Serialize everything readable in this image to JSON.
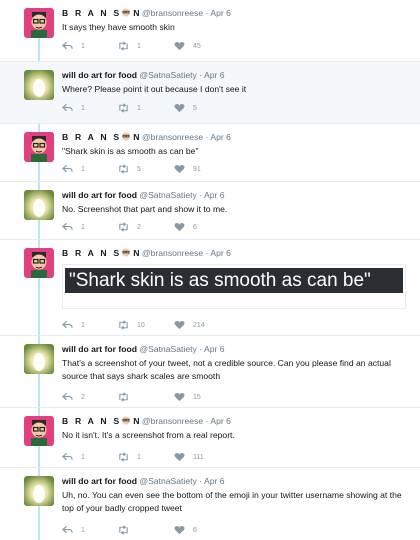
{
  "thread": {
    "tweets": [
      {
        "author": "BRANSON",
        "name_part1": "B R A N S",
        "name_part2": "N",
        "handle": "@bransonreese",
        "date": "Apr 6",
        "text": "It says they have smooth skin",
        "replies": "1",
        "retweets": "1",
        "likes": "45",
        "avatar": "cartoon-face-avatar"
      },
      {
        "author": "will do art for food",
        "handle": "@SatnaSatiety",
        "date": "Apr 6",
        "text": "Where? Please point it out because I don't see it",
        "replies": "1",
        "retweets": "1",
        "likes": "5",
        "avatar": "glowing-figure-avatar"
      },
      {
        "name_part1": "B R A N S",
        "name_part2": "N",
        "handle": "@bransonreese",
        "date": "Apr 6",
        "text": "\"Shark skin is as smooth as can be\"",
        "replies": "1",
        "retweets": "5",
        "likes": "91",
        "avatar": "cartoon-face-avatar"
      },
      {
        "author": "will do art for food",
        "handle": "@SatnaSatiety",
        "date": "Apr 6",
        "text": "No. Screenshot that part and show it to me.",
        "replies": "1",
        "retweets": "2",
        "likes": "6",
        "avatar": "glowing-figure-avatar"
      },
      {
        "name_part1": "B R A N S",
        "name_part2": "N",
        "handle": "@bransonreese",
        "date": "Apr 6",
        "screenshot_text": "\"Shark skin is as smooth as can be\"",
        "replies": "1",
        "retweets": "10",
        "likes": "214",
        "avatar": "cartoon-face-avatar"
      },
      {
        "author": "will do art for food",
        "handle": "@SatnaSatiety",
        "date": "Apr 6",
        "text": "That's a screenshot of your tweet, not a credible source. Can you please find an actual source that says shark scales are smooth",
        "replies": "2",
        "retweets": "",
        "likes": "15",
        "avatar": "glowing-figure-avatar"
      },
      {
        "name_part1": "B R A N S",
        "name_part2": "N",
        "handle": "@bransonreese",
        "date": "Apr 6",
        "text": "No it isn't. It's a screenshot from a real report.",
        "replies": "1",
        "retweets": "1",
        "likes": "111",
        "avatar": "cartoon-face-avatar"
      },
      {
        "author": "will do art for food",
        "handle": "@SatnaSatiety",
        "date": "Apr 6",
        "text": "Uh, no. You can even see the bottom of the emoji in your twitter username showing at the top of your badly cropped tweet",
        "replies": "1",
        "retweets": "",
        "likes": "6",
        "avatar": "glowing-figure-avatar"
      }
    ],
    "separator": "·",
    "colors": {
      "thread_line": "#b8e5f7",
      "meta": "#657786",
      "icons": "#8899a6",
      "shaded_bg": "#f5f8fa"
    }
  }
}
